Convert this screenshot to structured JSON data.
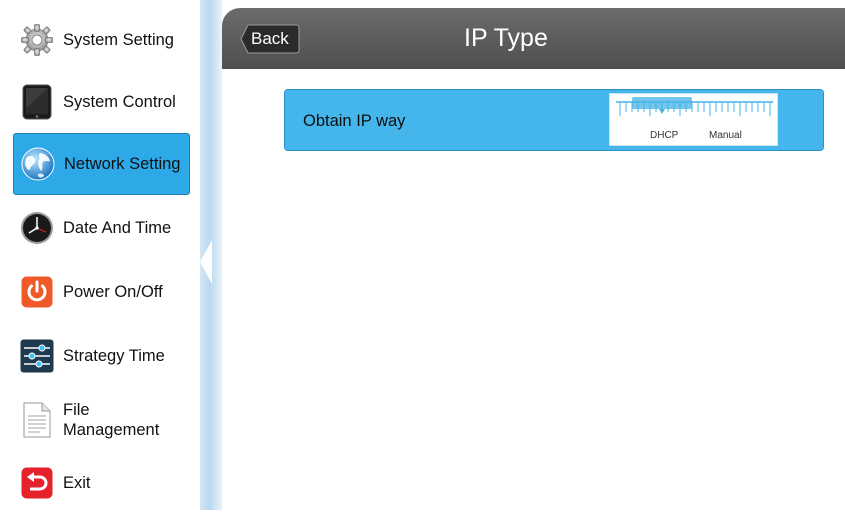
{
  "sidebar": {
    "items": [
      {
        "label": "System Setting",
        "icon": "gear-icon",
        "active": false
      },
      {
        "label": "System Control",
        "icon": "tablet-icon",
        "active": false
      },
      {
        "label": "Network Setting",
        "icon": "globe-icon",
        "active": true
      },
      {
        "label": "Date And Time",
        "icon": "clock-icon",
        "active": false
      },
      {
        "label": "Power On/Off",
        "icon": "power-icon",
        "active": false
      },
      {
        "label": "Strategy Time",
        "icon": "sliders-icon",
        "active": false
      },
      {
        "label": "File Management",
        "icon": "document-icon",
        "active": false
      },
      {
        "label": "Exit",
        "icon": "exit-icon",
        "active": false
      }
    ]
  },
  "header": {
    "back_label": "Back",
    "title": "IP Type"
  },
  "content": {
    "setting_label": "Obtain IP way",
    "options": [
      "DHCP",
      "Manual"
    ],
    "selected": "DHCP"
  },
  "colors": {
    "accent": "#2da9e8",
    "row_bg": "#45b6ec",
    "header_bg": "#555555"
  }
}
